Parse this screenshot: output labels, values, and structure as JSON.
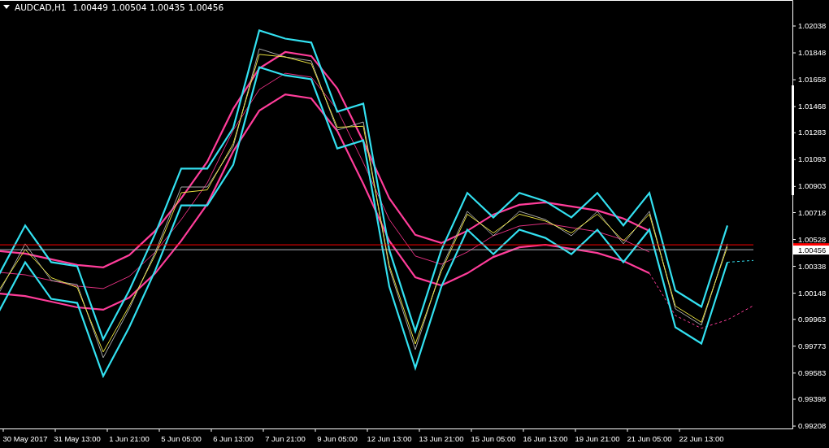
{
  "header": {
    "symbol": "AUDCAD,H1",
    "ohlc": [
      "1.00449",
      "1.00504",
      "1.00435",
      "1.00456"
    ]
  },
  "chart_data": {
    "type": "line",
    "categories": [
      null,
      "30 May 2017",
      null,
      "31 May 13:00",
      null,
      "1 Jun 21:00",
      null,
      "5 Jun 05:00",
      null,
      "6 Jun 13:00",
      null,
      "7 Jun 21:00",
      null,
      "9 Jun 05:00",
      null,
      "12 Jun 13:00",
      null,
      "13 Jun 21:00",
      null,
      "15 Jun 05:00",
      null,
      "16 Jun 13:00",
      null,
      "19 Jun 21:00",
      null,
      "21 Jun 05:00",
      null,
      "22 Jun 13:00",
      null,
      null
    ],
    "ylim": [
      0.99191,
      1.02222
    ],
    "yticks": [
      {
        "value": 1.02038,
        "label": "1.02038"
      },
      {
        "value": 1.01848,
        "label": "1.01848"
      },
      {
        "value": 1.01658,
        "label": "1.01658"
      },
      {
        "value": 1.01468,
        "label": "1.01468"
      },
      {
        "value": 1.01283,
        "label": "1.01283"
      },
      {
        "value": 1.01093,
        "label": "1.01093"
      },
      {
        "value": 1.00903,
        "label": "1.00903"
      },
      {
        "value": 1.00718,
        "label": "1.00718"
      },
      {
        "value": 1.00528,
        "label": "1.00528"
      },
      {
        "value": 1.00338,
        "label": "1.00338"
      },
      {
        "value": 1.00148,
        "label": "1.00148"
      },
      {
        "value": 0.99963,
        "label": "0.99963"
      },
      {
        "value": 0.99773,
        "label": "0.99773"
      },
      {
        "value": 0.99583,
        "label": "0.99583"
      },
      {
        "value": 0.99398,
        "label": "0.99398"
      },
      {
        "value": 0.99208,
        "label": "0.99208"
      }
    ],
    "series": [
      {
        "color": "#ff3d9a",
        "values": [
          1.00446,
          1.00428,
          1.00388,
          1.00348,
          1.00331,
          1.00417,
          1.00589,
          1.00819,
          1.01078,
          1.01452,
          1.01739,
          1.01854,
          1.01826,
          1.01596,
          1.01222,
          1.00819,
          1.00561,
          1.00503,
          1.00589,
          1.00704,
          1.00773,
          1.00791,
          1.00762,
          1.00733,
          1.00676,
          1.00589,
          null,
          null,
          null,
          null
        ]
      },
      {
        "color": "#e0307f",
        "values": [
          1.00296,
          1.00278,
          1.00238,
          1.00198,
          1.00181,
          1.00267,
          1.00439,
          1.00669,
          1.00928,
          1.01302,
          1.01589,
          1.01704,
          1.01676,
          1.01446,
          1.01072,
          1.00669,
          1.00411,
          1.00353,
          1.00439,
          1.00554,
          1.00623,
          1.00641,
          1.00612,
          1.00583,
          1.00526,
          1.00439,
          null,
          null,
          null,
          null
        ]
      },
      {
        "color": "#ff3d9a",
        "values": [
          1.00146,
          1.00128,
          1.00088,
          1.00048,
          1.00031,
          1.00117,
          1.00289,
          1.00519,
          1.00778,
          1.01152,
          1.01439,
          1.01554,
          1.01526,
          1.01296,
          1.00922,
          1.00519,
          1.00261,
          1.00203,
          1.00289,
          1.00404,
          1.00473,
          1.00491,
          1.00462,
          1.00433,
          1.00376,
          1.00289,
          null,
          null,
          null,
          null
        ]
      },
      {
        "color": "#ff3d9a",
        "line_style": "dashed",
        "values": [
          null,
          null,
          null,
          null,
          null,
          null,
          null,
          null,
          null,
          null,
          null,
          null,
          null,
          null,
          null,
          null,
          null,
          null,
          null,
          null,
          null,
          null,
          null,
          null,
          null,
          1.00289,
          0.9999,
          0.999,
          0.9996,
          1.0006
        ]
      },
      {
        "color": "#a8a8a8",
        "values": [
          1.00152,
          1.00497,
          1.00238,
          1.00209,
          0.99692,
          1.00037,
          1.00439,
          1.00899,
          1.00899,
          1.01187,
          1.01877,
          1.01819,
          1.01791,
          1.01302,
          1.01359,
          1.00324,
          0.99749,
          1.00324,
          1.00727,
          1.00554,
          1.00727,
          1.00669,
          1.00554,
          1.00727,
          1.00497,
          1.00727,
          1.00037,
          0.99922,
          1.00497,
          null
        ]
      },
      {
        "color": "#33e0f0",
        "values": [
          1.00282,
          1.00627,
          1.00368,
          1.00339,
          0.99822,
          1.00167,
          1.00569,
          1.01029,
          1.01029,
          1.01317,
          1.02007,
          1.01949,
          1.01921,
          1.01432,
          1.01489,
          1.00454,
          0.99879,
          1.00454,
          1.00857,
          1.00684,
          1.00857,
          1.00799,
          1.00684,
          1.00857,
          1.00627,
          1.00857,
          1.00167,
          1.00052,
          1.00627,
          null
        ]
      },
      {
        "color": "#33e0f0",
        "values": [
          1.00022,
          1.00367,
          1.00108,
          1.00079,
          0.99562,
          0.99907,
          1.00309,
          1.00769,
          1.00769,
          1.01057,
          1.01747,
          1.01689,
          1.01661,
          1.01172,
          1.01229,
          1.00194,
          0.99619,
          1.00194,
          1.00597,
          1.00424,
          1.00597,
          1.00539,
          1.00424,
          1.00597,
          1.00367,
          1.00597,
          0.99907,
          0.99792,
          1.00367,
          null
        ]
      },
      {
        "color": "#33e0f0",
        "line_style": "dashed",
        "values": [
          null,
          null,
          null,
          null,
          null,
          null,
          null,
          null,
          null,
          null,
          null,
          null,
          null,
          null,
          null,
          null,
          null,
          null,
          null,
          null,
          null,
          null,
          null,
          null,
          null,
          null,
          null,
          null,
          1.00367,
          1.0038
        ]
      },
      {
        "color": "#e8e040",
        "values": [
          1.00172,
          1.00457,
          1.00258,
          1.00189,
          0.99732,
          1.00057,
          1.00419,
          1.00859,
          1.00879,
          1.01207,
          1.01837,
          1.01819,
          1.01771,
          1.01322,
          1.01329,
          1.00344,
          0.99789,
          1.00304,
          1.00707,
          1.00574,
          1.00707,
          1.00659,
          1.00574,
          1.00707,
          1.00517,
          1.00707,
          1.00057,
          0.99942,
          1.00477,
          null
        ]
      },
      {
        "color": "#ff0000",
        "values": [
          1.0049,
          1.0049,
          1.0049,
          1.0049,
          1.0049,
          1.0049,
          1.0049,
          1.0049,
          1.0049,
          1.0049,
          1.0049,
          1.0049,
          1.0049,
          1.0049,
          1.0049,
          1.0049,
          1.0049,
          1.0049,
          1.0049,
          1.0049,
          1.0049,
          1.0049,
          1.0049,
          1.0049,
          1.0049,
          1.0049,
          1.0049,
          1.0049,
          1.0049,
          1.0049
        ]
      },
      {
        "color": "#b0b4bc",
        "values": [
          1.00456,
          1.00456,
          1.00456,
          1.00456,
          1.00456,
          1.00456,
          1.00456,
          1.00456,
          1.00456,
          1.00456,
          1.00456,
          1.00456,
          1.00456,
          1.00456,
          1.00456,
          1.00456,
          1.00456,
          1.00456,
          1.00456,
          1.00456,
          1.00456,
          1.00456,
          1.00456,
          1.00456,
          1.00456,
          1.00456,
          1.00456,
          1.00456,
          1.00456,
          1.00456
        ]
      }
    ]
  },
  "price_tags": [
    {
      "kind": "ask"
    },
    {
      "kind": "bid",
      "label": "1.00456"
    }
  ]
}
